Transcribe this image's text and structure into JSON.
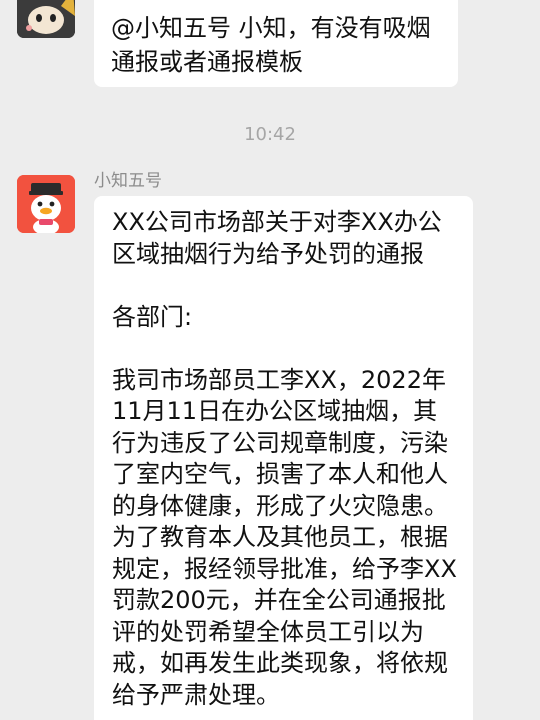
{
  "top_message": {
    "text_line1": "@小知五号 小知，有没有吸烟",
    "text_line2": "通报或者通报模板"
  },
  "time_divider": "10:42",
  "bot_message": {
    "sender": "小知五号",
    "title": "XX公司市场部关于对李XX办公区域抽烟行为给予处罚的通报",
    "greeting": "各部门:",
    "body": "我司市场部员工李XX，2022年11月11日在办公区域抽烟，其行为违反了公司规章制度，污染了室内空气，损害了本人和他人的身体健康，形成了火灾隐患。为了教育本人及其他员工，根据规定，报经领导批准，给予李XX罚款200元，并在全公司通报批评的处罚希望全体员工引以为戒，如再发生此类现象，将依规给予严肃处理。"
  },
  "colors": {
    "background": "#ededed",
    "bubble": "#ffffff",
    "time_text": "#a6a6a6",
    "sender_text": "#8c8c8c",
    "bot_avatar": "#f2523f"
  }
}
